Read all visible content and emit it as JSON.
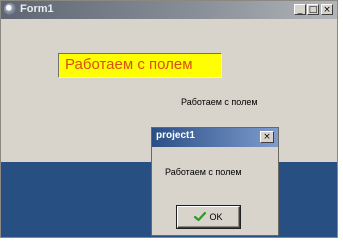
{
  "window": {
    "title": "Form1",
    "minimize": "_",
    "maximize": "□",
    "close": "×"
  },
  "edit": {
    "value": "Работаем с полем"
  },
  "label": {
    "text": "Работаем с полем"
  },
  "dialog": {
    "title": "project1",
    "close": "×",
    "message": "Работаем с полем",
    "ok_label": "OK"
  },
  "colors": {
    "edit_bg": "#ffff00",
    "edit_text": "#d85010",
    "band": "#284f82"
  },
  "icons": [
    "app-icon",
    "check-icon"
  ]
}
